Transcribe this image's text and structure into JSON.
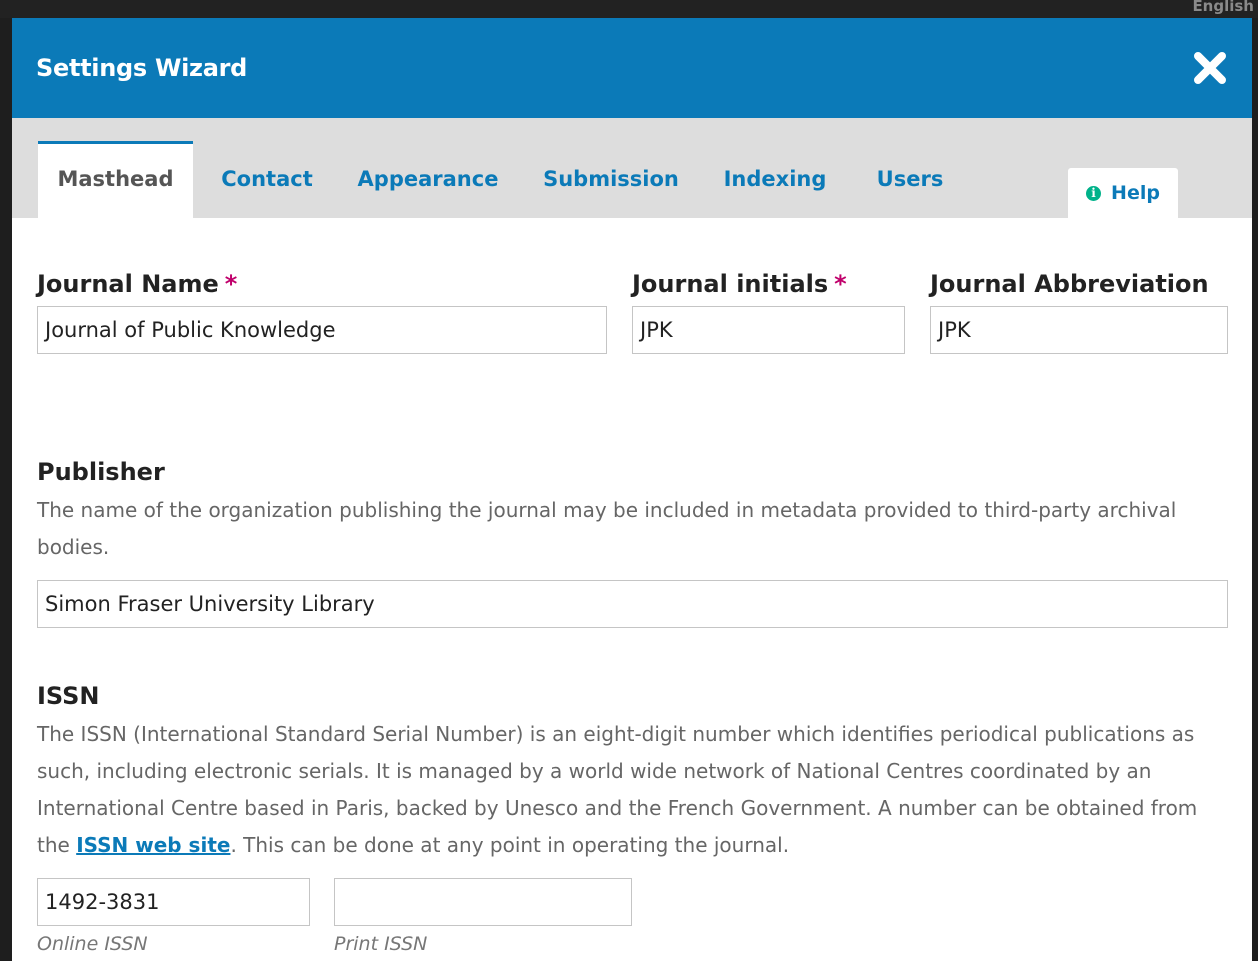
{
  "background": {
    "language_label": "English"
  },
  "modal": {
    "title": "Settings Wizard",
    "close_icon": "close-icon",
    "accent_color": "#0b7ab8",
    "required_color": "#c0006b"
  },
  "tabs": [
    {
      "label": "Masthead",
      "active": true
    },
    {
      "label": "Contact",
      "active": false
    },
    {
      "label": "Appearance",
      "active": false
    },
    {
      "label": "Submission",
      "active": false
    },
    {
      "label": "Indexing",
      "active": false
    },
    {
      "label": "Users",
      "active": false
    }
  ],
  "help": {
    "label": "Help",
    "icon": "info-icon"
  },
  "form": {
    "journal_name": {
      "label": "Journal Name",
      "required_mark": "*",
      "value": "Journal of Public Knowledge"
    },
    "journal_initials": {
      "label": "Journal initials",
      "required_mark": "*",
      "value": "JPK"
    },
    "journal_abbreviation": {
      "label": "Journal Abbreviation",
      "value": "JPK"
    },
    "publisher": {
      "label": "Publisher",
      "description": "The name of the organization publishing the journal may be included in metadata provided to third-party archival bodies.",
      "value": "Simon Fraser University Library"
    },
    "issn": {
      "label": "ISSN",
      "description_before": "The ISSN (International Standard Serial Number) is an eight-digit number which identifies periodical publications as such, including electronic serials. It is managed by a world wide network of National Centres coordinated by an International Centre based in Paris, backed by Unesco and the French Government. A number can be obtained from the ",
      "link_text": "ISSN web site",
      "description_after": ". This can be done at any point in operating the journal.",
      "online_value": "1492-3831",
      "online_label": "Online ISSN",
      "print_value": "",
      "print_label": "Print ISSN"
    }
  }
}
